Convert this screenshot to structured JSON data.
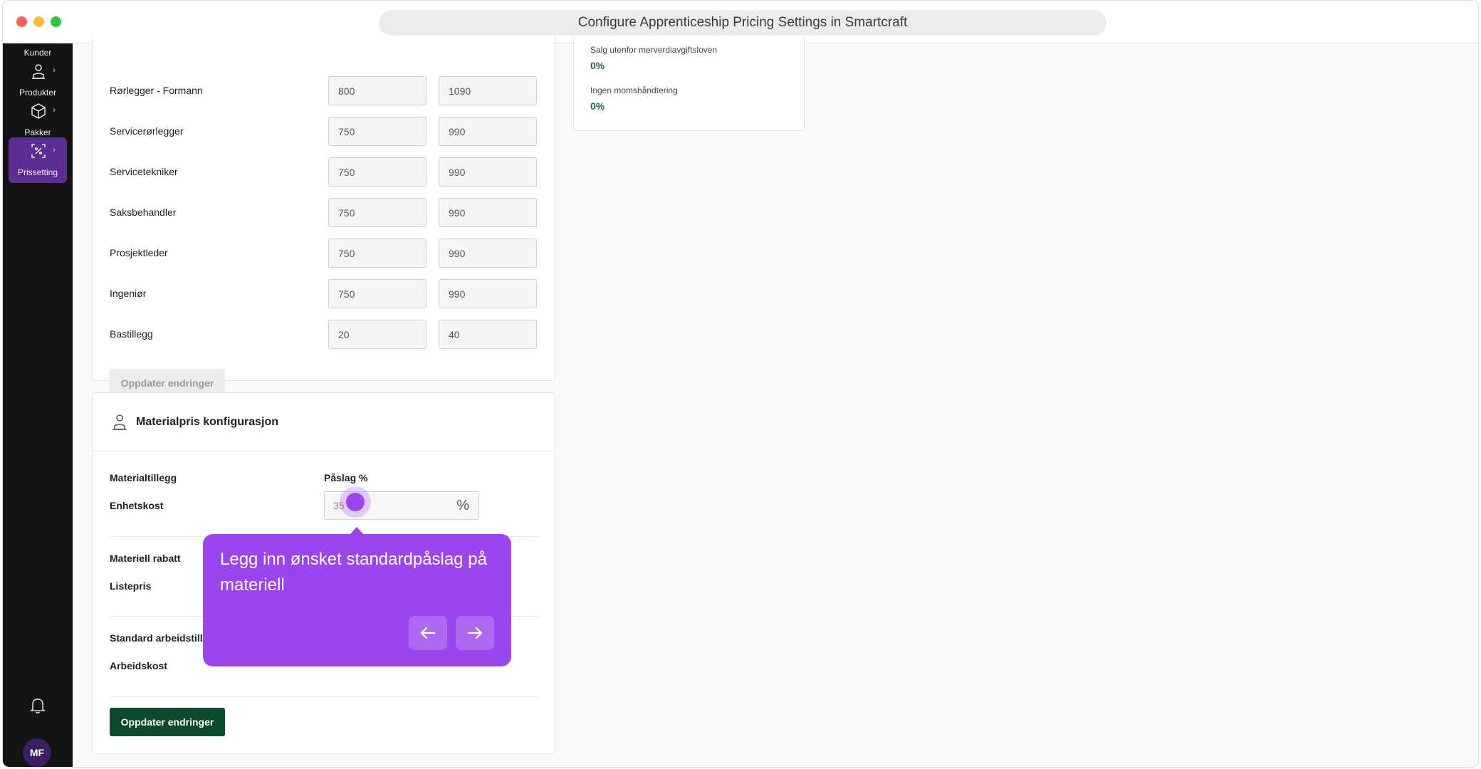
{
  "window": {
    "title": "Configure Apprenticeship Pricing Settings in Smartcraft"
  },
  "sidebar": {
    "kunder_label": "Kunder",
    "items": [
      {
        "label": "Produkter",
        "icon": "product-person-icon"
      },
      {
        "label": "Pakker",
        "icon": "package-icon"
      },
      {
        "label": "Prissetting",
        "icon": "pricing-icon",
        "active": true
      }
    ],
    "avatar_initials": "MF"
  },
  "rates": {
    "rows": [
      {
        "label": "Rørlegger - Formann",
        "value_a": "800",
        "value_b": "1090"
      },
      {
        "label": "Servicerørlegger",
        "value_a": "750",
        "value_b": "990"
      },
      {
        "label": "Servicetekniker",
        "value_a": "750",
        "value_b": "990"
      },
      {
        "label": "Saksbehandler",
        "value_a": "750",
        "value_b": "990"
      },
      {
        "label": "Prosjektleder",
        "value_a": "750",
        "value_b": "990"
      },
      {
        "label": "Ingeniør",
        "value_a": "750",
        "value_b": "990"
      },
      {
        "label": "Bastillegg",
        "value_a": "20",
        "value_b": "40"
      }
    ],
    "update_button": "Oppdater endringer"
  },
  "vat": {
    "items": [
      {
        "label": "Salg utenfor merverdiavgiftsloven",
        "value": "0%"
      },
      {
        "label": "Ingen momshåndtering",
        "value": "0%"
      }
    ]
  },
  "material": {
    "title": "Materialpris konfigurasjon",
    "materialtillegg": "Materialtillegg",
    "paslag_header": "Påslag %",
    "enhetskost": "Enhetskost",
    "enhetskost_value": "35",
    "percent_symbol": "%",
    "materiell_rabatt": "Materiell rabatt",
    "listepris": "Listepris",
    "standard_arbeid": "Standard arbeidstille",
    "arbeidskost": "Arbeidskost",
    "update_button": "Oppdater endringer"
  },
  "tour": {
    "text": "Legg inn ønsket standardpåslag på materiell"
  },
  "colors": {
    "sidebar_bg": "#131313",
    "sidebar_active": "#5b2c91",
    "primary_green": "#0b4a2a",
    "value_green": "#1a6b3c",
    "tour_purple": "#9b45ee"
  }
}
